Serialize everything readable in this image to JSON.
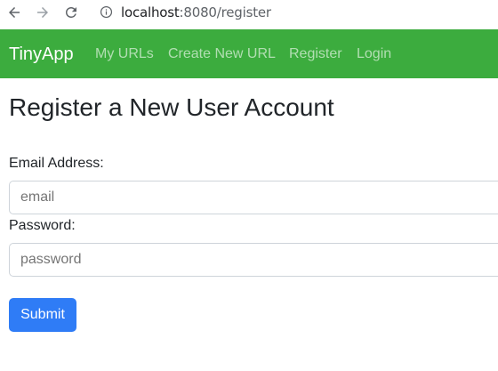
{
  "browser": {
    "url_host": "localhost",
    "url_rest": ":8080/register"
  },
  "navbar": {
    "brand": "TinyApp",
    "links": [
      "My URLs",
      "Create New URL",
      "Register",
      "Login"
    ],
    "color": "#3cac3e"
  },
  "main": {
    "title": "Register a New User Account",
    "email_label": "Email Address:",
    "email_placeholder": "email",
    "email_value": "",
    "password_label": "Password:",
    "password_placeholder": "password",
    "password_value": "",
    "submit_label": "Submit",
    "submit_color": "#2f7cf6"
  }
}
